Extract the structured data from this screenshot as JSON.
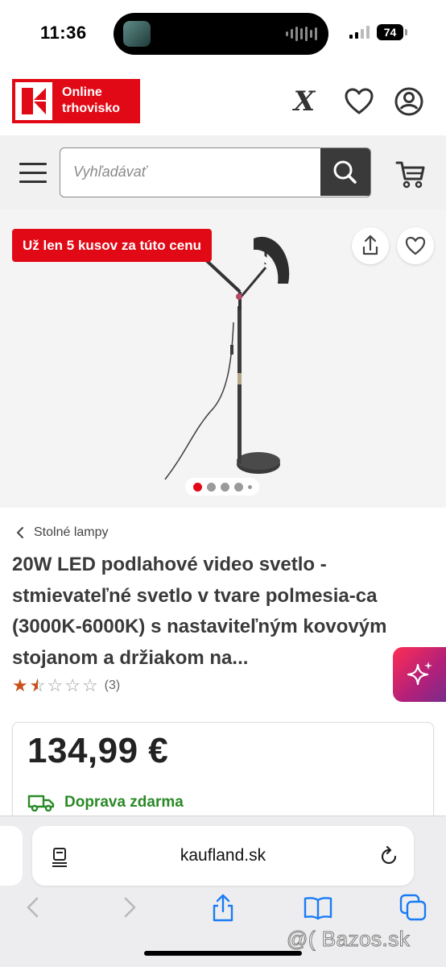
{
  "status": {
    "time": "11:36",
    "battery": "74"
  },
  "header": {
    "logo_line1": "Online",
    "logo_line2": "trhovisko",
    "icons": [
      "x-brand-icon",
      "heart-icon",
      "user-icon"
    ]
  },
  "search": {
    "placeholder": "Vyhľadávať"
  },
  "gallery": {
    "badge": "Už len 5 kusov za túto cenu",
    "image_count": 5,
    "active_index": 0
  },
  "product": {
    "breadcrumb": "Stolné lampy",
    "title": "20W LED podlahové video svetlo - stmievateľné svetlo v tvare polmesia-ca (3000K-6000K) s nastaviteľným kovovým stojanom a držiakom na...",
    "rating_stars": 1.5,
    "rating_max": 5,
    "rating_count": "(3)",
    "price": "134,99 €",
    "shipping": "Doprava zdarma"
  },
  "colors": {
    "brand": "#e10915",
    "shipping_green": "#2a8a26",
    "star": "#c8511a"
  },
  "browser": {
    "url": "kaufland.sk"
  },
  "watermark": "@( Bazos.sk"
}
